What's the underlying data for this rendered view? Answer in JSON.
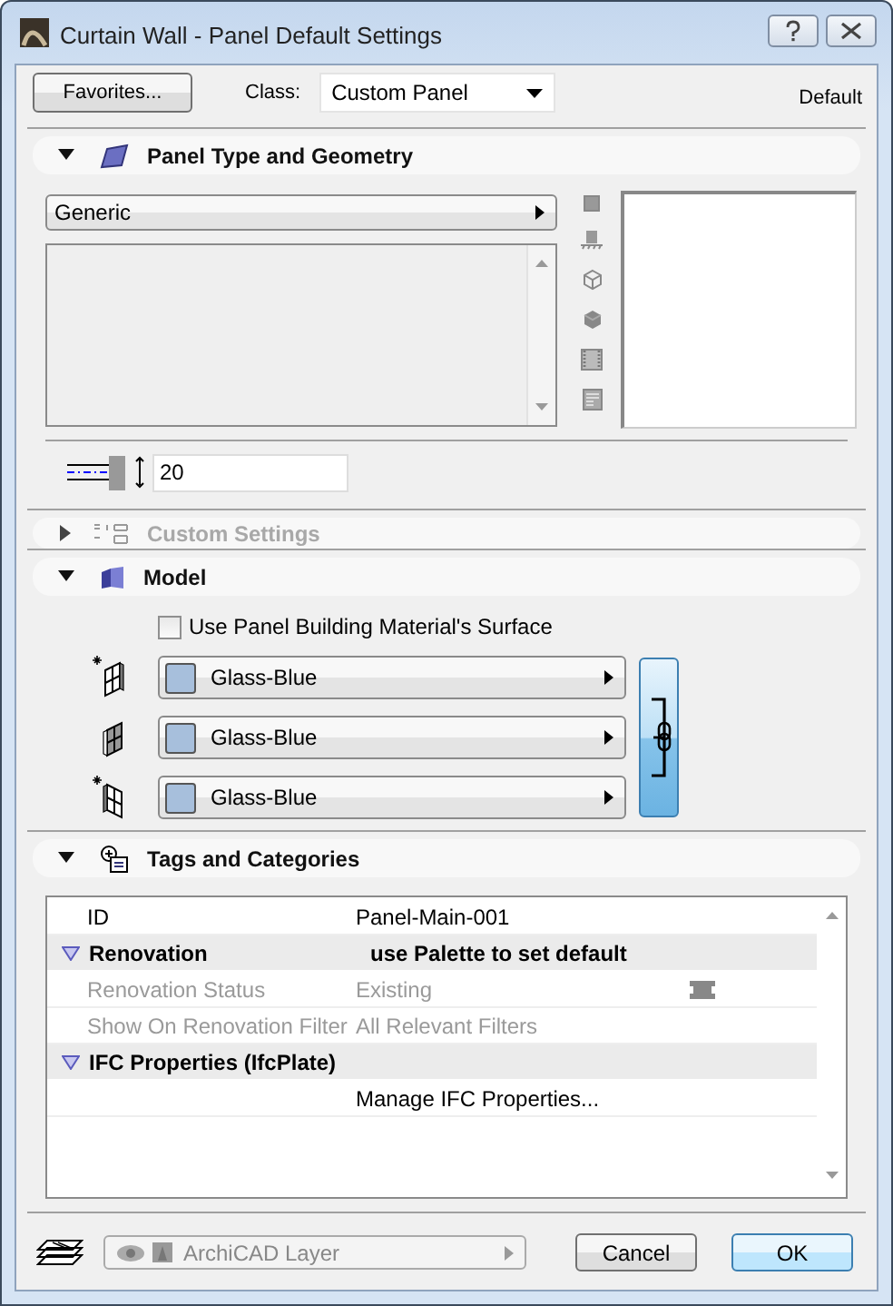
{
  "window": {
    "title": "Curtain Wall - Panel Default Settings"
  },
  "toolbar": {
    "favorites_button": "Favorites...",
    "class_label": "Class:",
    "class_value": "Custom Panel",
    "status": "Default"
  },
  "panel_type": {
    "title": "Panel Type and Geometry",
    "expanded": true,
    "type_value": "Generic",
    "thickness": "20"
  },
  "custom_settings": {
    "title": "Custom Settings",
    "expanded": false,
    "disabled": true
  },
  "model": {
    "title": "Model",
    "expanded": true,
    "use_material_surface": {
      "label": "Use Panel Building Material's Surface",
      "checked": false
    },
    "materials": [
      {
        "name": "Glass-Blue"
      },
      {
        "name": "Glass-Blue"
      },
      {
        "name": "Glass-Blue"
      }
    ],
    "linked": true
  },
  "tags": {
    "title": "Tags and Categories",
    "expanded": true,
    "rows": [
      {
        "kind": "field",
        "label": "ID",
        "value": "Panel-Main-001",
        "disabled": false,
        "renovation_icon": false
      },
      {
        "kind": "group",
        "label": "Renovation",
        "value": "use Palette to set default",
        "expanded": true
      },
      {
        "kind": "field",
        "label": "Renovation Status",
        "value": "Existing",
        "disabled": true,
        "renovation_icon": true
      },
      {
        "kind": "field",
        "label": "Show On Renovation Filter",
        "value": "All Relevant Filters",
        "disabled": true,
        "renovation_icon": false
      },
      {
        "kind": "group",
        "label": "IFC Properties (IfcPlate)",
        "expanded": true
      },
      {
        "kind": "field",
        "value": "Manage IFC Properties...",
        "disabled": false,
        "renovation_icon": false
      }
    ]
  },
  "footer": {
    "layer": "ArchiCAD Layer",
    "layer_disabled": true,
    "buttons": [
      {
        "label": "Cancel",
        "default": false
      },
      {
        "label": "OK",
        "default": true
      }
    ]
  }
}
